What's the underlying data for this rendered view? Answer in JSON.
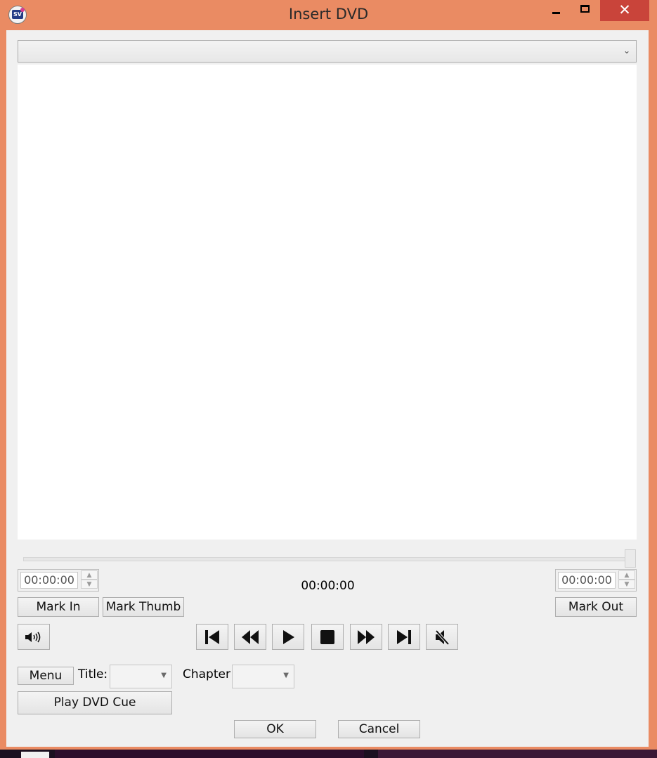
{
  "window": {
    "title": "Insert DVD",
    "close_glyph": "✕",
    "accent_color": "#ea8b63",
    "close_color": "#c9443a"
  },
  "dvd_select": {
    "value": "",
    "chevron": "⌄"
  },
  "position": {
    "seek_fraction": 1.0
  },
  "mark_in_time": {
    "value": "00:00:00",
    "up": "▲",
    "down": "▼"
  },
  "mark_out_time": {
    "value": "00:00:00",
    "up": "▲",
    "down": "▼"
  },
  "current_time": "00:00:00",
  "buttons": {
    "mark_in": "Mark In",
    "mark_thumb": "Mark Thumb",
    "mark_out": "Mark Out",
    "menu": "Menu",
    "play_dvd_cue": "Play DVD Cue",
    "ok": "OK",
    "cancel": "Cancel"
  },
  "labels": {
    "title": "Title:",
    "chapter": "Chapter"
  },
  "combos": {
    "title_value": "",
    "chapter_value": "",
    "arrow": "▼"
  },
  "transport_icons": [
    "volume-icon",
    "skip-back-icon",
    "rewind-icon",
    "play-icon",
    "stop-icon",
    "fast-forward-icon",
    "skip-forward-icon",
    "mute-icon"
  ]
}
